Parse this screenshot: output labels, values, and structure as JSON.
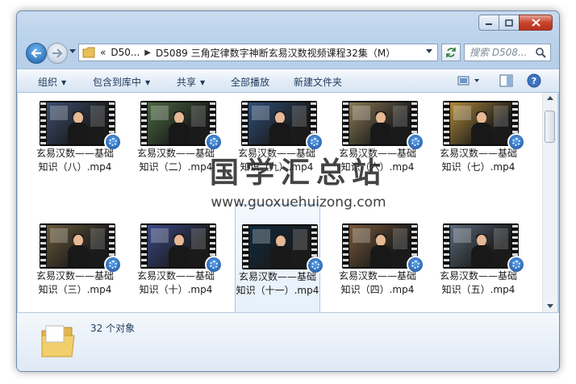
{
  "window": {
    "address_overflow": "«",
    "breadcrumbs": [
      "D50...",
      "D5089 三角定律数字神断玄易汉数视频课程32集（M）"
    ],
    "search_placeholder": "搜索 D508..."
  },
  "toolbar": {
    "organize": "组织",
    "include_library": "包含到库中",
    "share": "共享",
    "play_all": "全部播放",
    "new_folder": "新建文件夹"
  },
  "files": [
    {
      "label": "玄易汉数——基础知识（八）.mp4",
      "theme": "#3d4f72"
    },
    {
      "label": "玄易汉数——基础知识（二）.mp4",
      "theme": "#4a6a40"
    },
    {
      "label": "玄易汉数——基础知识（九）.mp4",
      "theme": "#2e4f7a"
    },
    {
      "label": "玄易汉数——基础知识（六）.mp4",
      "theme": "#8a7a55"
    },
    {
      "label": "玄易汉数——基础知识（七）.mp4",
      "theme": "#b08a3a"
    },
    {
      "label": "玄易汉数——基础知识（三）.mp4",
      "theme": "#6a5a3a"
    },
    {
      "label": "玄易汉数——基础知识（十）.mp4",
      "theme": "#3a4a8a"
    },
    {
      "label": "玄易汉数——基础知识（十一）.mp4",
      "theme": "#0e2a3e"
    },
    {
      "label": "玄易汉数——基础知识（四）.mp4",
      "theme": "#7a5a3a"
    },
    {
      "label": "玄易汉数——基础知识（五）.mp4",
      "theme": "#5a6a7a"
    }
  ],
  "status": {
    "count": "32 个对象"
  },
  "watermark": {
    "text": "国学汇总站",
    "url": "www.guoxuehuizong.com"
  }
}
